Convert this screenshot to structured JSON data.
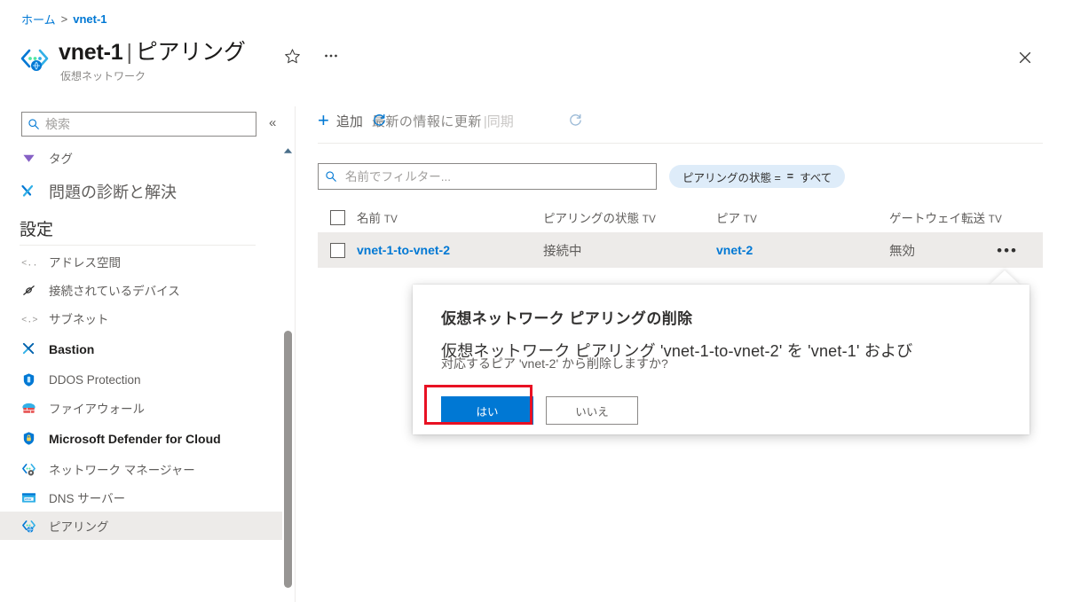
{
  "breadcrumb": {
    "home": "ホーム",
    "separator": ">",
    "current": "vnet-1"
  },
  "header": {
    "resource_name": "vnet-1",
    "separator": "|",
    "section": "ピアリング",
    "subtitle": "仮想ネットワーク",
    "resource_icon": "virtual-network-icon",
    "favorite_icon": "star-icon",
    "more_icon": "ellipsis-icon",
    "close_icon": "close-icon"
  },
  "sidebar": {
    "search": {
      "placeholder": "検索",
      "value": "",
      "icon": "search-icon"
    },
    "collapse_icon": "chevron-double-left-icon",
    "items": [
      {
        "label": "タグ",
        "icon": "tag-icon",
        "style": "tiny",
        "selected": false
      },
      {
        "label": "問題の診断と解決",
        "icon": "wrench-icon",
        "style": "big",
        "selected": false
      }
    ],
    "group": {
      "title": "設定"
    },
    "settings_items": [
      {
        "label": "アドレス空間",
        "icon": "address-space-icon",
        "bold": false,
        "selected": false
      },
      {
        "label": "接続されているデバイス",
        "icon": "connected-devices-icon",
        "bold": false,
        "selected": false
      },
      {
        "label": "サブネット",
        "icon": "subnet-icon",
        "bold": false,
        "selected": false
      },
      {
        "label": "Bastion",
        "icon": "bastion-icon",
        "bold": true,
        "selected": false
      },
      {
        "label": "DDOS Protection",
        "icon": "shield-icon",
        "bold": false,
        "selected": false
      },
      {
        "label": "ファイアウォール",
        "icon": "firewall-icon",
        "bold": false,
        "selected": false
      },
      {
        "label": "Microsoft Defender for Cloud",
        "icon": "defender-shield-icon",
        "bold": true,
        "selected": false
      },
      {
        "label": "ネットワーク マネージャー",
        "icon": "network-manager-icon",
        "bold": false,
        "selected": false
      },
      {
        "label": "DNS サーバー",
        "icon": "dns-server-icon",
        "bold": false,
        "selected": false
      },
      {
        "label": "ピアリング",
        "icon": "peering-icon",
        "bold": false,
        "selected": true
      }
    ]
  },
  "toolbar": {
    "add_label": "追加",
    "add_icon": "plus-icon",
    "refresh_label": "最新の情報に更新",
    "refresh_icon": "refresh-icon",
    "sync_separator": "|",
    "sync_label": "同期"
  },
  "filters": {
    "name_filter": {
      "placeholder": "名前でフィルター...",
      "value": "",
      "icon": "search-icon"
    },
    "state_pill": {
      "field": "ピアリングの状態 =",
      "operator": "=",
      "value": "すべて"
    }
  },
  "table": {
    "columns": [
      {
        "label": "名前",
        "sort_marker": "TV"
      },
      {
        "label": "ピアリングの状態",
        "sort_marker": "TV"
      },
      {
        "label": "ピア",
        "sort_marker": "TV"
      },
      {
        "label": "ゲートウェイ転送",
        "sort_marker": "TV"
      }
    ],
    "rows": [
      {
        "checked": false,
        "name": "vnet-1-to-vnet-2",
        "state": "接続中",
        "peer": "vnet-2",
        "gateway_transit": "無効",
        "menu_icon": "ellipsis-icon"
      }
    ]
  },
  "dialog": {
    "title": "仮想ネットワーク ピアリングの削除",
    "message_line1": "仮想ネットワーク ピアリング 'vnet-1-to-vnet-2' を 'vnet-1' および",
    "message_line2": "対応するピア 'vnet-2' から削除しますか?",
    "confirm_label": "はい",
    "cancel_label": "いいえ"
  },
  "colors": {
    "accent": "#0078d4",
    "highlight_border": "#e81123",
    "row_selected_bg": "#edebe9",
    "pill_bg": "#deecf9"
  }
}
